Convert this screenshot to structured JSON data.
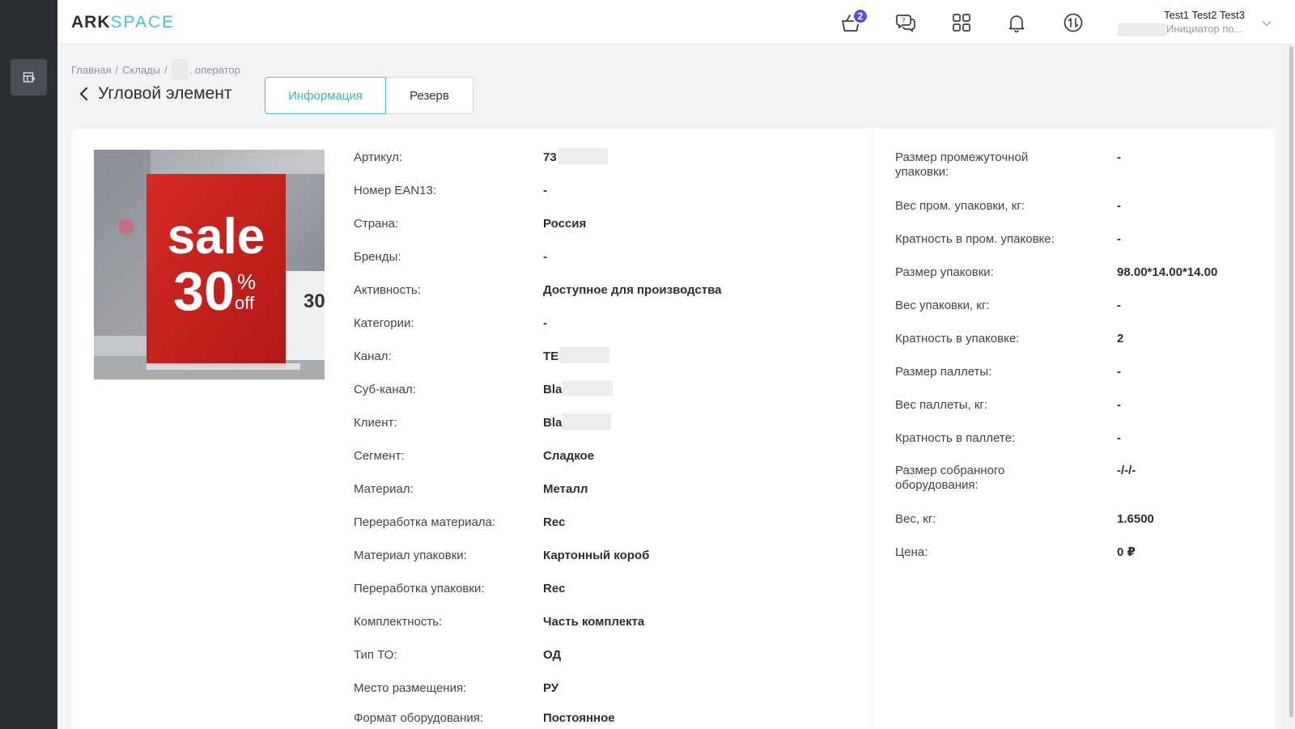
{
  "brand": {
    "part1": "ARK",
    "part2": "SPACE"
  },
  "header": {
    "cart_badge": "2",
    "user": {
      "name": "Test1 Test2 Test3",
      "role": "Инициатор по..."
    }
  },
  "breadcrumb": {
    "home": "Главная",
    "warehouses": "Склады",
    "operator": ". оператор",
    "separator": "/"
  },
  "page": {
    "title": "Угловой элемент"
  },
  "tabs": [
    {
      "label": "Информация",
      "active": true
    },
    {
      "label": "Резерв",
      "active": false
    }
  ],
  "product_image": {
    "sign_line1": "sale",
    "sign_line2": "30",
    "sign_pct": "%",
    "sign_off": "off",
    "side_sign": "30"
  },
  "details_left": [
    {
      "label": "Артикул:",
      "value": "73"
    },
    {
      "label": "Номер EAN13:",
      "value": "-"
    },
    {
      "label": "Страна:",
      "value": "Россия"
    },
    {
      "label": "Бренды:",
      "value": "-"
    },
    {
      "label": "Активность:",
      "value": "Доступное для производства"
    },
    {
      "label": "Категории:",
      "value": "-"
    },
    {
      "label": "Канал:",
      "value": "TE"
    },
    {
      "label": "Суб-канал:",
      "value": "Bla"
    },
    {
      "label": "Клиент:",
      "value": "Bla"
    },
    {
      "label": "Сегмент:",
      "value": "Сладкое"
    },
    {
      "label": "Материал:",
      "value": "Металл"
    },
    {
      "label": "Переработка материала:",
      "value": "Rec"
    },
    {
      "label": "Материал упаковки:",
      "value": "Картонный короб"
    },
    {
      "label": "Переработка упаковки:",
      "value": "Rec"
    },
    {
      "label": "Комплектность:",
      "value": "Часть комплекта"
    },
    {
      "label": "Тип ТО:",
      "value": "ОД"
    },
    {
      "label": "Место размещения:",
      "value": "РУ"
    },
    {
      "label": "Формат оборудования:",
      "value": "Постоянное"
    }
  ],
  "details_right": [
    {
      "label_l1": "Размер промежуточной",
      "label_l2": "упаковки:",
      "value": "-"
    },
    {
      "label_l1": "Вес пром. упаковки, кг:",
      "label_l2": "",
      "value": "-"
    },
    {
      "label_l1": "Кратность в пром. упаковке:",
      "label_l2": "",
      "value": "-"
    },
    {
      "label_l1": "Размер упаковки:",
      "label_l2": "",
      "value": "98.00*14.00*14.00"
    },
    {
      "label_l1": "Вес упаковки, кг:",
      "label_l2": "",
      "value": "-"
    },
    {
      "label_l1": "Кратность в упаковке:",
      "label_l2": "",
      "value": "2"
    },
    {
      "label_l1": "Размер паллеты:",
      "label_l2": "",
      "value": "-"
    },
    {
      "label_l1": "Вес паллеты, кг:",
      "label_l2": "",
      "value": "-"
    },
    {
      "label_l1": "Кратность в паллете:",
      "label_l2": "",
      "value": "-"
    },
    {
      "label_l1": "Размер собранного",
      "label_l2": "оборудования:",
      "value": "-/-/-"
    },
    {
      "label_l1": "Вес, кг:",
      "label_l2": "",
      "value": "1.6500"
    },
    {
      "label_l1": "Цена:",
      "label_l2": "",
      "value": "0 ₽"
    }
  ]
}
